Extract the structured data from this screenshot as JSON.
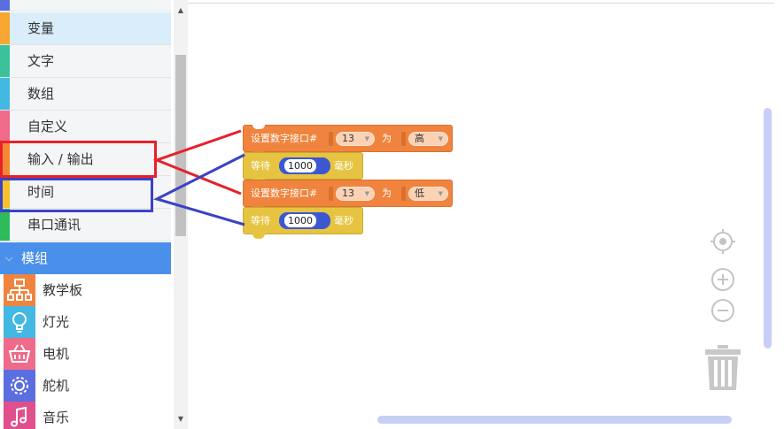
{
  "sidebar": {
    "categories": [
      {
        "label": "变量",
        "color": "#f7a731",
        "selected": true
      },
      {
        "label": "文字",
        "color": "#3cc29a"
      },
      {
        "label": "数组",
        "color": "#43b8e3"
      },
      {
        "label": "自定义",
        "color": "#f06a8a"
      },
      {
        "label": "输入 / 输出",
        "color": "#f58734"
      },
      {
        "label": "时间",
        "color": "#f4c02b"
      },
      {
        "label": "串口通讯",
        "color": "#2fba5b"
      }
    ],
    "module_header": {
      "label": "模组",
      "chevron_icon": "chevron-down-icon"
    },
    "modules": [
      {
        "label": "教学板",
        "icon": "board-icon",
        "color": "#f0843e"
      },
      {
        "label": "灯光",
        "icon": "bulb-icon",
        "color": "#43b8e3"
      },
      {
        "label": "电机",
        "icon": "motor-icon",
        "color": "#f06a8a"
      },
      {
        "label": "舵机",
        "icon": "servo-icon",
        "color": "#5b6ee0"
      },
      {
        "label": "音乐",
        "icon": "music-icon",
        "color": "#e0508c"
      }
    ]
  },
  "blocks": {
    "set_pin_1": {
      "prefix": "设置数字接口#",
      "pin": "13",
      "middle": "为",
      "level": "高"
    },
    "wait_1": {
      "prefix": "等待",
      "value": "1000",
      "unit": "毫秒"
    },
    "set_pin_2": {
      "prefix": "设置数字接口#",
      "pin": "13",
      "middle": "为",
      "level": "低"
    },
    "wait_2": {
      "prefix": "等待",
      "value": "1000",
      "unit": "毫秒"
    }
  },
  "colors": {
    "io_block": "#f0843e",
    "time_block": "#e6c441",
    "number_input": "#3c57d2",
    "annotation_red": "#e8202a",
    "annotation_blue": "#3b42c4",
    "module_header": "#4a8fea"
  },
  "workspace_controls": {
    "recenter_icon": "crosshair-icon",
    "zoom_in_icon": "zoom-in-icon",
    "zoom_out_icon": "zoom-out-icon",
    "trash_icon": "trash-icon"
  }
}
